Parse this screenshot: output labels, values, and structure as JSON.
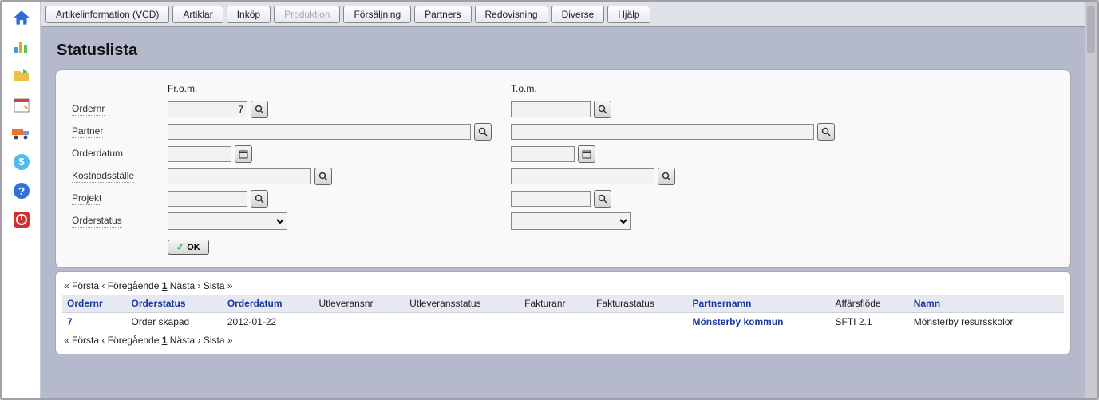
{
  "sidebar": {
    "items": [
      {
        "name": "home-icon"
      },
      {
        "name": "chart-icon"
      },
      {
        "name": "folder-icon"
      },
      {
        "name": "calendar-icon"
      },
      {
        "name": "truck-icon"
      },
      {
        "name": "money-icon"
      },
      {
        "name": "help-icon"
      },
      {
        "name": "power-icon"
      }
    ]
  },
  "topnav": {
    "tabs": [
      {
        "label": "Artikelinformation (VCD)"
      },
      {
        "label": "Artiklar"
      },
      {
        "label": "Inköp"
      },
      {
        "label": "Produktion",
        "disabled": true
      },
      {
        "label": "Försäljning"
      },
      {
        "label": "Partners"
      },
      {
        "label": "Redovisning"
      },
      {
        "label": "Diverse"
      },
      {
        "label": "Hjälp"
      }
    ]
  },
  "page": {
    "title": "Statuslista"
  },
  "filter": {
    "col_from": "Fr.o.m.",
    "col_to": "T.o.m.",
    "labels": {
      "ordernr": "Ordernr",
      "partner": "Partner",
      "orderdatum": "Orderdatum",
      "kostnadsstalle": "Kostnadsställe",
      "projekt": "Projekt",
      "orderstatus": "Orderstatus"
    },
    "values": {
      "ordernr_from": "7",
      "ordernr_to": "",
      "partner_from": "",
      "partner_to": "",
      "orderdatum_from": "",
      "orderdatum_to": "",
      "kostnad_from": "",
      "kostnad_to": "",
      "projekt_from": "",
      "projekt_to": "",
      "status_from": "",
      "status_to": ""
    },
    "ok_label": "OK"
  },
  "pager": {
    "first": "« Första",
    "prev": "‹ Föregående",
    "current": "1",
    "next": "Nästa ›",
    "last": "Sista »"
  },
  "table": {
    "headers": {
      "ordernr": "Ordernr",
      "orderstatus": "Orderstatus",
      "orderdatum": "Orderdatum",
      "utleveransnr": "Utleveransnr",
      "utleveransstatus": "Utleveransstatus",
      "fakturanr": "Fakturanr",
      "fakturastatus": "Fakturastatus",
      "partnernamn": "Partnernamn",
      "affarsflode": "Affärsflöde",
      "namn": "Namn"
    },
    "rows": [
      {
        "ordernr": "7",
        "orderstatus": "Order skapad",
        "orderdatum": "2012-01-22",
        "utleveransnr": "",
        "utleveransstatus": "",
        "fakturanr": "",
        "fakturastatus": "",
        "partnernamn": "Mönsterby kommun",
        "affarsflode": "SFTI 2.1",
        "namn": "Mönsterby resursskolor"
      }
    ]
  }
}
